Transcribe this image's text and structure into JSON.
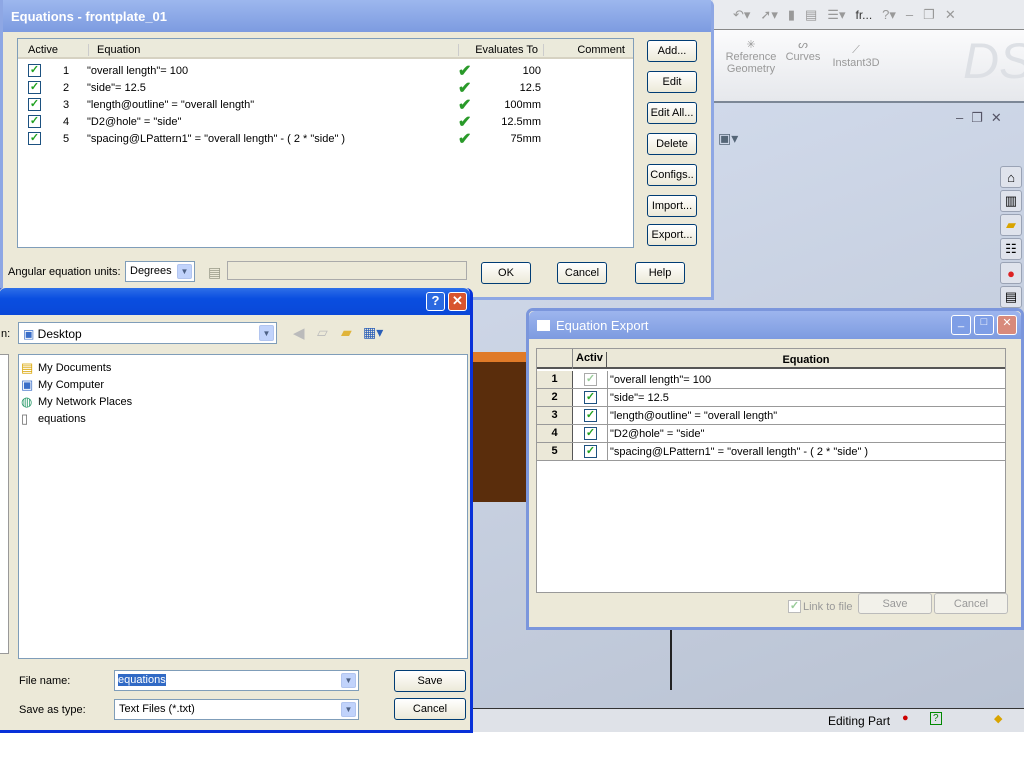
{
  "sw": {
    "toolbar_title": "fr...",
    "ribbon": [
      {
        "label": "Reference Geometry"
      },
      {
        "label": "Curves"
      },
      {
        "label": "Instant3D"
      }
    ],
    "status": {
      "mode": "Editing Part"
    },
    "task_pane_icons": [
      "home-icon",
      "resources-icon",
      "folder-icon",
      "library-icon",
      "appearance-icon",
      "properties-icon"
    ]
  },
  "equations": {
    "title": "Equations - frontplate_01",
    "columns": [
      "Active",
      "Equation",
      "Evaluates To",
      "Comment"
    ],
    "rows": [
      {
        "num": "1",
        "equation": "\"overall length\"= 100",
        "value": "100"
      },
      {
        "num": "2",
        "equation": "\"side\"= 12.5",
        "value": "12.5"
      },
      {
        "num": "3",
        "equation": "\"length@outline\" = \"overall length\"",
        "value": "100mm"
      },
      {
        "num": "4",
        "equation": "\"D2@hole\" = \"side\"",
        "value": "12.5mm"
      },
      {
        "num": "5",
        "equation": "\"spacing@LPattern1\" = \"overall length\" -  ( 2 * \"side\" )",
        "value": "75mm"
      }
    ],
    "buttons": {
      "add": "Add...",
      "edit": "Edit",
      "edit_all": "Edit All...",
      "delete": "Delete",
      "configs": "Configs..",
      "import": "Import...",
      "export": "Export..."
    },
    "angular_label": "Angular equation units:",
    "angular_value": "Degrees",
    "ok": "OK",
    "cancel": "Cancel",
    "help": "Help"
  },
  "save_dialog": {
    "save_in_label": "n:",
    "save_in": "Desktop",
    "files": [
      {
        "name": "My Documents",
        "icon": "my-documents-icon"
      },
      {
        "name": "My Computer",
        "icon": "my-computer-icon"
      },
      {
        "name": "My Network Places",
        "icon": "network-places-icon"
      },
      {
        "name": "equations",
        "icon": "text-file-icon"
      }
    ],
    "file_name_label": "File name:",
    "file_name": "equations",
    "type_label": "Save as type:",
    "type": "Text Files (*.txt)",
    "save": "Save",
    "cancel": "Cancel"
  },
  "export": {
    "title": "Equation Export",
    "columns": [
      "Activ",
      "Equation"
    ],
    "rows": [
      {
        "num": "1",
        "equation": "\"overall length\"= 100"
      },
      {
        "num": "2",
        "equation": "\"side\"= 12.5"
      },
      {
        "num": "3",
        "equation": "\"length@outline\" = \"overall length\""
      },
      {
        "num": "4",
        "equation": "\"D2@hole\" = \"side\""
      },
      {
        "num": "5",
        "equation": "\"spacing@LPattern1\" = \"overall length\" -  ( 2 * \"side\" )"
      }
    ],
    "link_label": "Link to file",
    "save": "Save",
    "cancel": "Cancel"
  }
}
